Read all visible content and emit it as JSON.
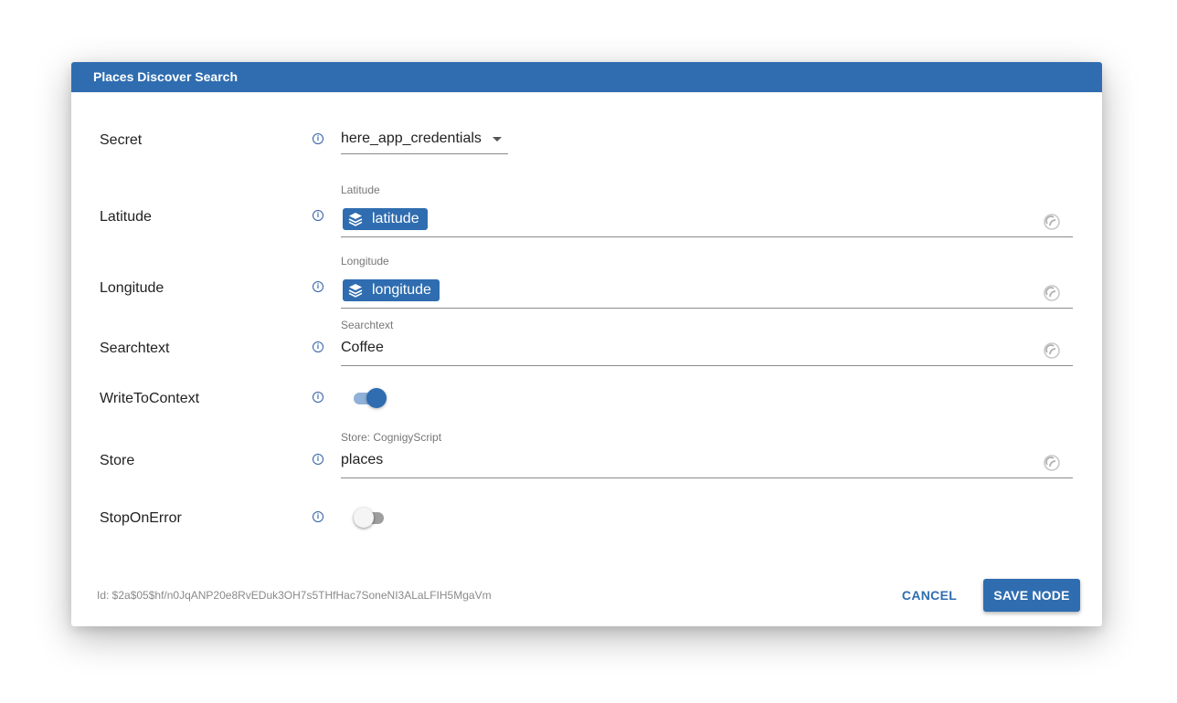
{
  "dialog": {
    "title": "Places Discover Search"
  },
  "fields": {
    "secret": {
      "label": "Secret",
      "value": "here_app_credentials"
    },
    "latitude": {
      "label": "Latitude",
      "float_label": "Latitude",
      "chip": "latitude"
    },
    "longitude": {
      "label": "Longitude",
      "float_label": "Longitude",
      "chip": "longitude"
    },
    "searchtext": {
      "label": "Searchtext",
      "float_label": "Searchtext",
      "value": "Coffee"
    },
    "write_to_context": {
      "label": "WriteToContext",
      "checked": true
    },
    "store": {
      "label": "Store",
      "float_label": "Store: CognigyScript",
      "value": "places"
    },
    "stop_on_error": {
      "label": "StopOnError",
      "checked": false
    }
  },
  "info_icon_glyph": "i",
  "footer": {
    "id_text": "Id: $2a$05$hf/n0JqANP20e8RvEDuk3OH7s5THfHac7SoneNI3ALaLFIH5MgaVm",
    "cancel_label": "CANCEL",
    "save_label": "SAVE NODE"
  },
  "colors": {
    "accent": "#2f6db0",
    "toggle_on_track": "#8fb1d8",
    "toggle_off_track": "#9e9e9e"
  },
  "icons": {
    "info": "info-circle-icon",
    "chip": "layers-icon",
    "script": "cognigy-script-icon",
    "dropdown": "caret-down-icon"
  }
}
